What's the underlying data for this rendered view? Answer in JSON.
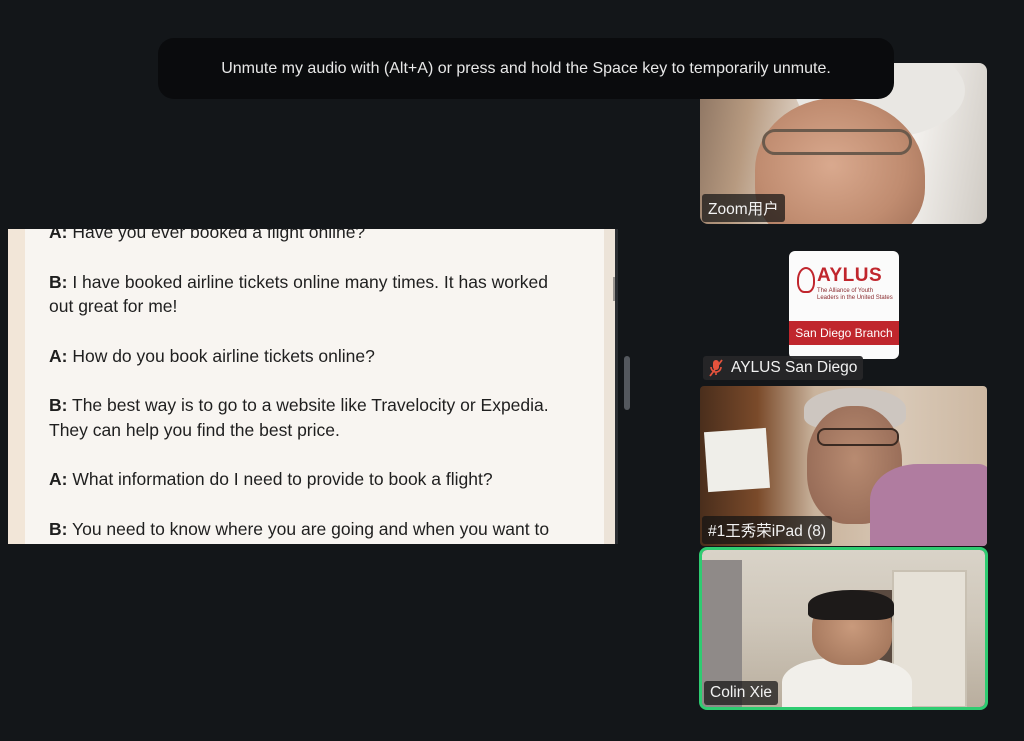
{
  "toast": {
    "message": "Unmute my audio with (Alt+A) or press and hold the Space key to temporarily unmute."
  },
  "shared_screen": {
    "lines": [
      {
        "speaker": "A:",
        "text": " Have you ever booked a flight online?"
      },
      {
        "speaker": "B:",
        "text": " I have booked airline tickets online many times. It has worked"
      },
      {
        "speaker": "",
        "text": "out great for me!"
      },
      {
        "speaker": "A:",
        "text": " How do you book airline tickets online?"
      },
      {
        "speaker": "B:",
        "text": " The best way is to go to a website like Travelocity or Expedia."
      },
      {
        "speaker": "",
        "text": "They can help you find the best price."
      },
      {
        "speaker": "A:",
        "text": " What information do I need to provide to book a flight?"
      },
      {
        "speaker": "B:",
        "text": " You need to know where you are going and when you want to"
      }
    ]
  },
  "participants": [
    {
      "name": "Zoom用户"
    },
    {
      "name": "AYLUS San Diego",
      "muted": true,
      "icon": "mic-off-icon",
      "avatar": {
        "logo": "AYLUS",
        "tagline": "The Alliance of Youth Leaders in the United States",
        "banner": "San Diego Branch"
      }
    },
    {
      "name": "#1王秀荣iPad (8)"
    },
    {
      "name": "Colin Xie",
      "active_speaker": true
    }
  ],
  "colors": {
    "background": "#131619",
    "active_border": "#2ecc71",
    "aylus_red": "#c0262d"
  }
}
